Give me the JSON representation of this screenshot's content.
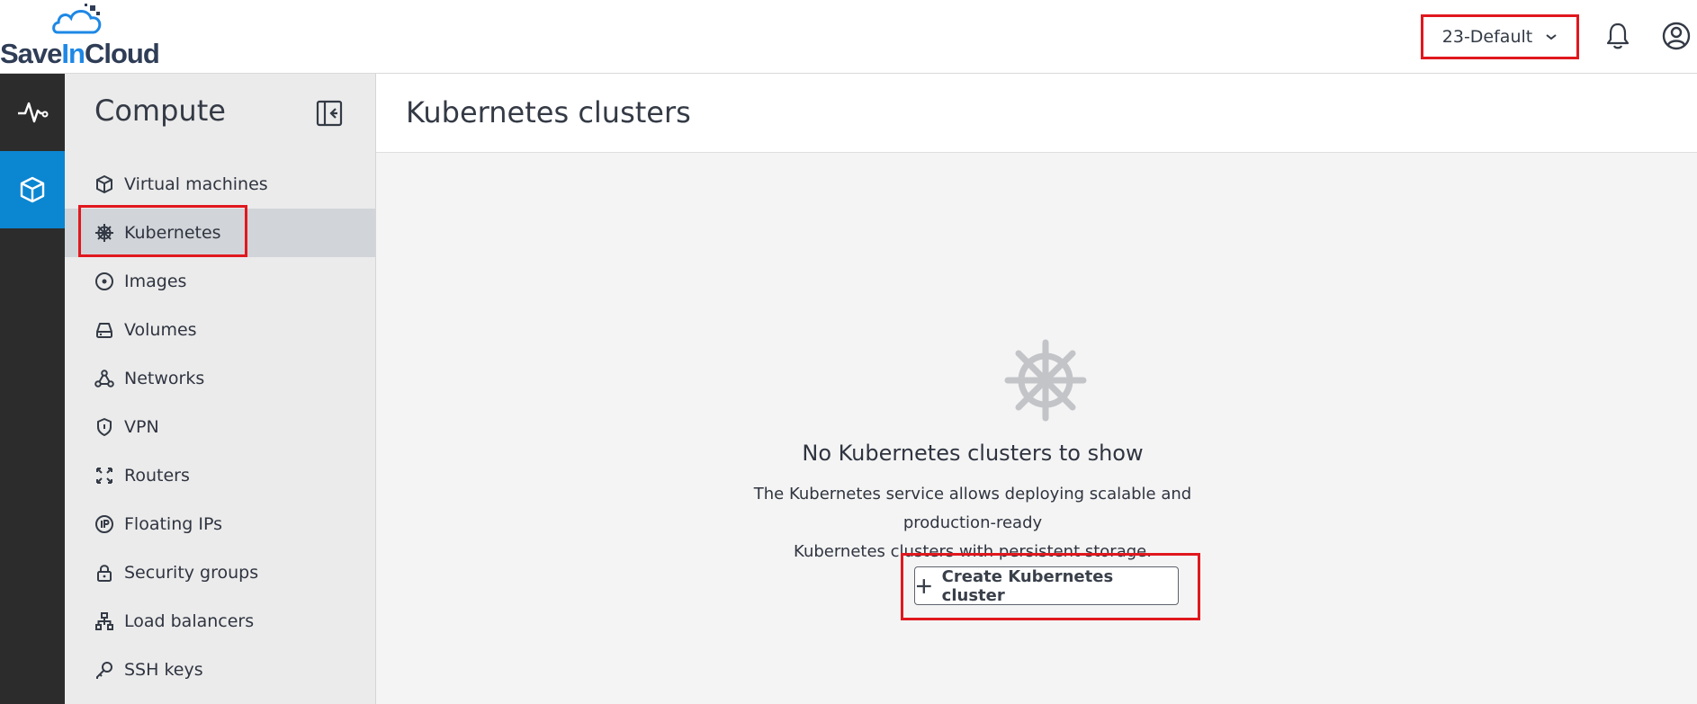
{
  "header": {
    "logo_text_a": "Save",
    "logo_text_b": "In",
    "logo_text_c": "Cloud",
    "project_selector": "23-Default",
    "icons": [
      "chevron-down-icon",
      "bell-icon",
      "user-circle-icon"
    ]
  },
  "rail": {
    "items": [
      {
        "icon": "activity-icon",
        "active": false
      },
      {
        "icon": "cube-icon",
        "active": true
      }
    ]
  },
  "sidebar": {
    "title": "Compute",
    "items": [
      {
        "label": "Virtual machines",
        "icon": "cube-icon"
      },
      {
        "label": "Kubernetes",
        "icon": "helm-icon",
        "selected": true
      },
      {
        "label": "Images",
        "icon": "disc-icon"
      },
      {
        "label": "Volumes",
        "icon": "hard-drive-icon"
      },
      {
        "label": "Networks",
        "icon": "network-icon"
      },
      {
        "label": "VPN",
        "icon": "shield-icon"
      },
      {
        "label": "Routers",
        "icon": "arrows-icon"
      },
      {
        "label": "Floating IPs",
        "icon": "ip-icon"
      },
      {
        "label": "Security groups",
        "icon": "lock-icon"
      },
      {
        "label": "Load balancers",
        "icon": "hierarchy-icon"
      },
      {
        "label": "SSH keys",
        "icon": "key-icon"
      }
    ]
  },
  "main": {
    "title": "Kubernetes clusters",
    "empty_title": "No Kubernetes clusters to show",
    "empty_desc_line1": "The Kubernetes service allows deploying scalable and production-ready",
    "empty_desc_line2": "Kubernetes clusters with persistent storage.",
    "create_button": "Create Kubernetes cluster"
  },
  "colors": {
    "accent": "#0b86d1",
    "highlight": "#e0181e",
    "rail": "#2c2c2c"
  }
}
